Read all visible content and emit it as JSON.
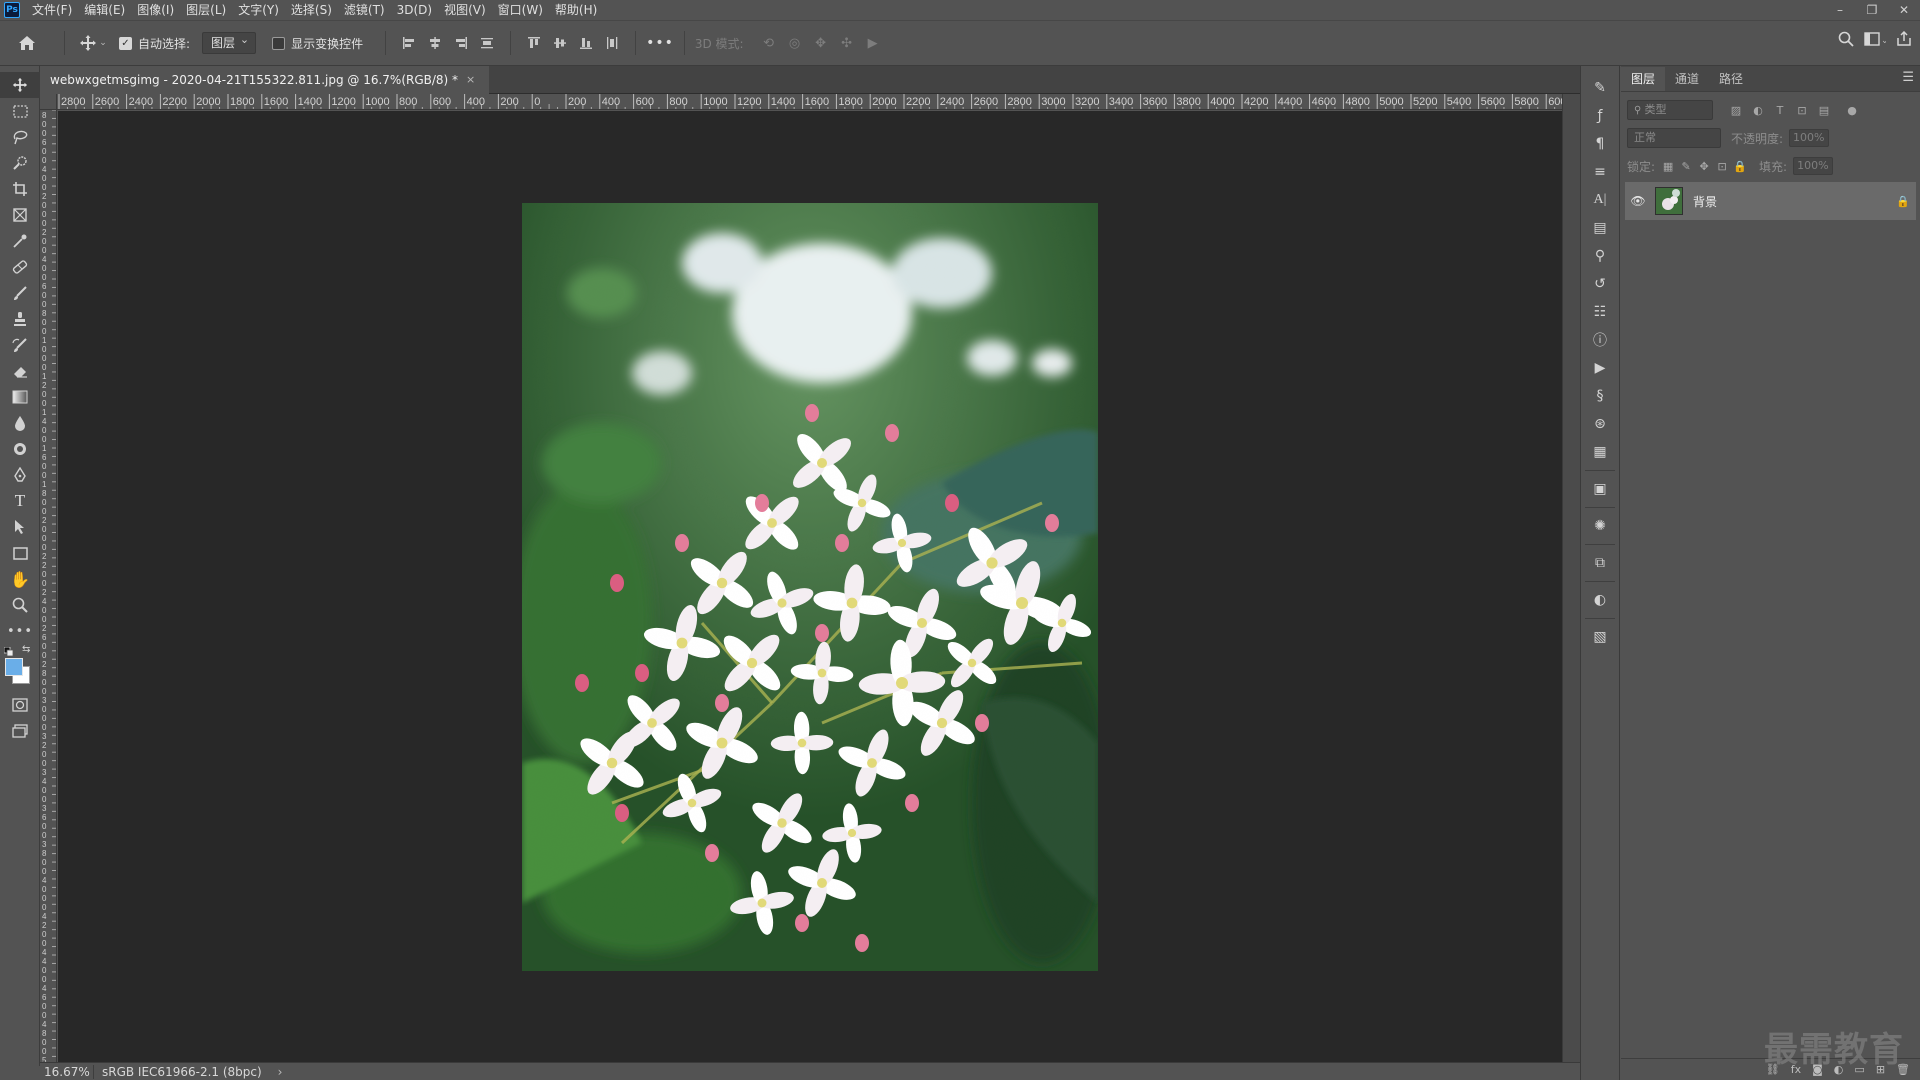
{
  "app": {
    "logo_text": "Ps"
  },
  "menu": [
    "文件(F)",
    "编辑(E)",
    "图像(I)",
    "图层(L)",
    "文字(Y)",
    "选择(S)",
    "滤镜(T)",
    "3D(D)",
    "视图(V)",
    "窗口(W)",
    "帮助(H)"
  ],
  "window_controls": {
    "minimize": "–",
    "restore": "❐",
    "close": "✕"
  },
  "options": {
    "auto_select_label": "自动选择:",
    "auto_select_checked": true,
    "layer_select_value": "图层",
    "show_transform_label": "显示变换控件",
    "show_transform_checked": false,
    "more_label": "•••",
    "mode_3d_label": "3D 模式:"
  },
  "document": {
    "tab_title": "webwxgetmsgimg - 2020-04-21T155322.811.jpg @ 16.7%(RGB/8) *",
    "close_symbol": "×"
  },
  "ruler": {
    "h_labels": [
      "2800",
      "2600",
      "2400",
      "2200",
      "2000",
      "1800",
      "1600",
      "1400",
      "1200",
      "1000",
      "800",
      "600",
      "400",
      "200",
      "0",
      "200",
      "400",
      "600",
      "800",
      "1000",
      "1200",
      "1400",
      "1600",
      "1800",
      "2000",
      "2200",
      "2400",
      "2600",
      "2800",
      "3000",
      "3200",
      "3400",
      "3600",
      "3800",
      "4000",
      "4200",
      "4400",
      "4600",
      "4800",
      "5000",
      "5200",
      "5400",
      "5600",
      "5800",
      "6000",
      "6"
    ],
    "v_labels": [
      "8",
      "0",
      "0",
      "6",
      "0",
      "0",
      "4",
      "0",
      "0",
      "2",
      "0",
      "0",
      "0",
      "2",
      "0",
      "0",
      "4",
      "0",
      "0",
      "6",
      "0",
      "0",
      "8",
      "0",
      "0",
      "1",
      "0",
      "0",
      "0",
      "1",
      "2",
      "0",
      "0",
      "1",
      "4",
      "0",
      "0",
      "1",
      "6",
      "0",
      "0",
      "1",
      "8",
      "0",
      "0",
      "2",
      "0",
      "0",
      "0",
      "2",
      "2",
      "0",
      "0",
      "2",
      "4",
      "0",
      "0",
      "2",
      "6",
      "0",
      "0",
      "2",
      "8",
      "0",
      "0",
      "3",
      "0",
      "0",
      "0",
      "3",
      "2",
      "0",
      "0",
      "3",
      "4",
      "0",
      "0",
      "3",
      "6",
      "0",
      "0",
      "3",
      "8",
      "0",
      "0",
      "4",
      "0",
      "0",
      "0",
      "4",
      "2",
      "0",
      "0",
      "4",
      "4",
      "0",
      "0",
      "4",
      "6",
      "0",
      "0",
      "4",
      "8",
      "0",
      "0",
      "5",
      "0"
    ]
  },
  "status": {
    "zoom": "16.67%",
    "color_profile": "sRGB IEC61966-2.1 (8bpc)",
    "arrow": "›"
  },
  "panel": {
    "tabs": [
      "图层",
      "通道",
      "路径"
    ],
    "active_tab": 0,
    "filter_placeholder": "类型",
    "blend_mode": "正常",
    "opacity_label": "不透明度:",
    "opacity_value": "100%",
    "lock_label": "锁定:",
    "fill_label": "填充:",
    "fill_value": "100%",
    "layers": [
      {
        "name": "背景",
        "visible": true,
        "locked": true
      }
    ]
  },
  "watermark": "最需教育",
  "colors": {
    "foreground": "#6aaee8",
    "background": "#ffffff",
    "accent": "#31a8ff"
  },
  "icons": {
    "tools": [
      "move-icon",
      "marquee-icon",
      "lasso-icon",
      "quick-select-icon",
      "crop-icon",
      "frame-icon",
      "eyedropper-icon",
      "healing-brush-icon",
      "brush-icon",
      "clone-stamp-icon",
      "history-brush-icon",
      "eraser-icon",
      "gradient-icon",
      "blur-icon",
      "dodge-icon",
      "pen-icon",
      "type-icon",
      "path-select-icon",
      "rectangle-icon",
      "hand-icon",
      "zoom-icon",
      "more-tools-icon"
    ]
  }
}
